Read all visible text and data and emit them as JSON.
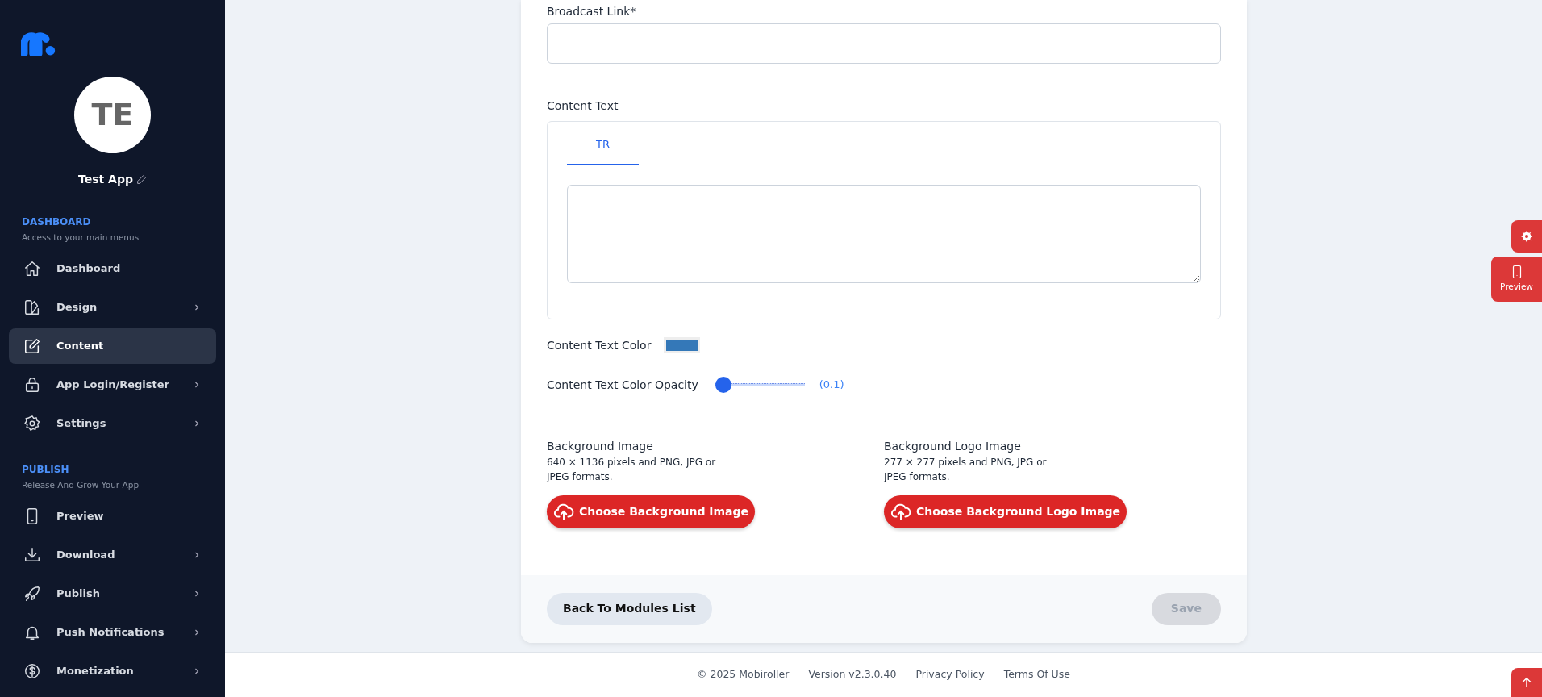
{
  "sidebar": {
    "avatar_initials": "TE",
    "app_name": "Test App",
    "sections": [
      {
        "title": "DASHBOARD",
        "subtitle": "Access to your main menus",
        "items": [
          {
            "label": "Dashboard",
            "kind": "home",
            "has_submenu": false,
            "selected": false
          },
          {
            "label": "Design",
            "kind": "design",
            "has_submenu": true,
            "selected": false
          },
          {
            "label": "Content",
            "kind": "edit",
            "has_submenu": false,
            "selected": true
          },
          {
            "label": "App Login/Register",
            "kind": "lock",
            "has_submenu": true,
            "selected": false
          },
          {
            "label": "Settings",
            "kind": "gear",
            "has_submenu": true,
            "selected": false
          }
        ]
      },
      {
        "title": "PUBLISH",
        "subtitle": "Release And Grow Your App",
        "items": [
          {
            "label": "Preview",
            "kind": "phone",
            "has_submenu": false,
            "selected": false
          },
          {
            "label": "Download",
            "kind": "download",
            "has_submenu": true,
            "selected": false
          },
          {
            "label": "Publish",
            "kind": "rocket",
            "has_submenu": true,
            "selected": false
          },
          {
            "label": "Push Notifications",
            "kind": "bell",
            "has_submenu": true,
            "selected": false
          },
          {
            "label": "Monetization",
            "kind": "dollar",
            "has_submenu": true,
            "selected": false
          }
        ]
      }
    ]
  },
  "form": {
    "broadcast_link": {
      "label": "Broadcast Link*"
    },
    "content_text": {
      "label": "Content Text",
      "tabs": [
        {
          "label": "TR",
          "selected": true
        }
      ]
    },
    "text_color": {
      "label": "Content Text Color",
      "color": "#3478b8"
    },
    "opacity": {
      "label": "Content Text Color Opacity",
      "level": 0.1,
      "reading": "(0.1)"
    },
    "uploads": [
      {
        "title": "Background Image",
        "hint": "640 × 1136 pixels and PNG, JPG or JPEG formats.",
        "button": "Choose Background Image"
      },
      {
        "title": "Background Logo Image",
        "hint": "277 × 277 pixels and PNG, JPG or JPEG formats.",
        "button": "Choose Background Logo Image"
      }
    ],
    "back_button": "Back To Modules List",
    "save_button": {
      "label": "Save",
      "disabled": true
    }
  },
  "floating": {
    "preview_label": "Preview"
  },
  "footer": [
    "© 2025 Mobiroller",
    "Version v2.3.0.40",
    "Privacy Policy",
    "Terms Of Use"
  ]
}
